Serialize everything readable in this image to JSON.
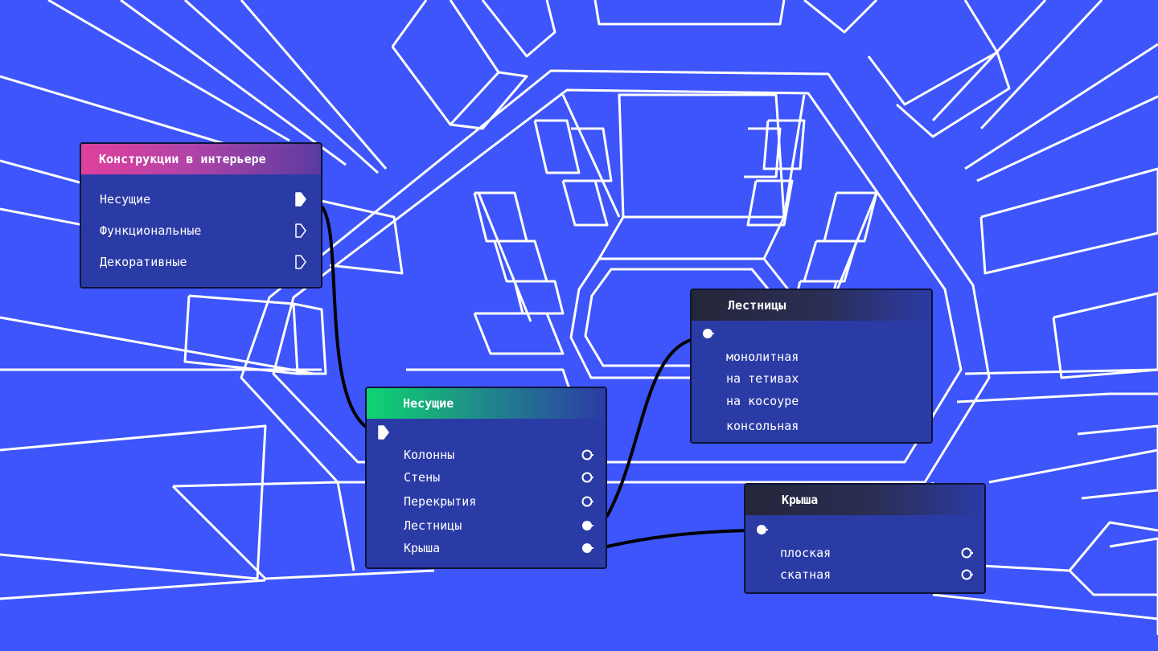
{
  "colors": {
    "background": "#3d55fb",
    "node_body": "#2b3ba6",
    "node_border": "#0d1338",
    "line": "#ffffff",
    "wire": "#000000",
    "header_construction": [
      "#e1409c",
      "#5a3ba0"
    ],
    "header_bearing": [
      "#0ed472",
      "#2b3ba6"
    ],
    "header_dark": [
      "#24263a",
      "#2b3ba6"
    ]
  },
  "nodes": {
    "constructions": {
      "title": "Конструкции в интерьере",
      "outputs": [
        {
          "label": "Несущие",
          "icon": "port-arrow-filled-icon"
        },
        {
          "label": "Функциональные",
          "icon": "port-arrow-outline-icon"
        },
        {
          "label": "Декоративные",
          "icon": "port-arrow-outline-icon"
        }
      ]
    },
    "bearing": {
      "title": "Несущие",
      "input_icon": "port-arrow-filled-icon",
      "outputs": [
        {
          "label": "Колонны",
          "icon": "port-circle-outline-icon"
        },
        {
          "label": "Стены",
          "icon": "port-circle-outline-icon"
        },
        {
          "label": "Перекрытия",
          "icon": "port-circle-outline-icon"
        },
        {
          "label": "Лестницы",
          "icon": "port-circle-filled-icon"
        },
        {
          "label": "Крыша",
          "icon": "port-circle-filled-icon"
        }
      ]
    },
    "stairs": {
      "title": "Лестницы",
      "input_icon": "port-circle-filled-icon",
      "items": [
        "монолитная",
        "на тетивах",
        "на косоуре",
        "консольная"
      ]
    },
    "roof": {
      "title": "Крыша",
      "input_icon": "port-circle-filled-icon",
      "outputs": [
        {
          "label": "плоская",
          "icon": "port-circle-outline-icon"
        },
        {
          "label": "скатная",
          "icon": "port-circle-outline-icon"
        }
      ]
    }
  }
}
